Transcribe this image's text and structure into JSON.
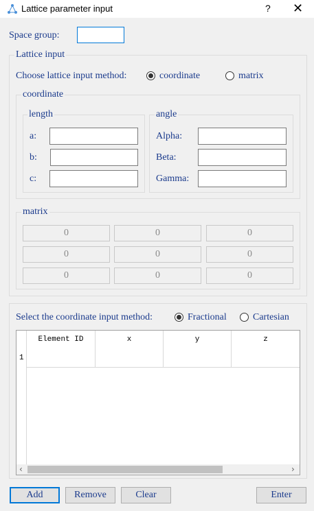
{
  "window": {
    "title": "Lattice parameter input",
    "help_label": "?",
    "close_label": "✕"
  },
  "space_group": {
    "label": "Space group:",
    "value": ""
  },
  "lattice": {
    "group_title": "Lattice input",
    "method_label": "Choose lattice input method:",
    "options": [
      {
        "label": "coordinate",
        "checked": true
      },
      {
        "label": "matrix",
        "checked": false
      }
    ],
    "coordinate": {
      "title": "coordinate",
      "length": {
        "title": "length",
        "fields": [
          {
            "label": "a:",
            "value": ""
          },
          {
            "label": "b:",
            "value": ""
          },
          {
            "label": "c:",
            "value": ""
          }
        ]
      },
      "angle": {
        "title": "angle",
        "fields": [
          {
            "label": "Alpha:",
            "value": ""
          },
          {
            "label": "Beta:",
            "value": ""
          },
          {
            "label": "Gamma:",
            "value": ""
          }
        ]
      }
    },
    "matrix": {
      "title": "matrix",
      "cells": [
        [
          "0",
          "0",
          "0"
        ],
        [
          "0",
          "0",
          "0"
        ],
        [
          "0",
          "0",
          "0"
        ]
      ]
    }
  },
  "coordinates": {
    "method_label": "Select the coordinate input method:",
    "options": [
      {
        "label": "Fractional",
        "checked": true
      },
      {
        "label": "Cartesian",
        "checked": false
      }
    ],
    "table": {
      "columns": [
        "Element ID",
        "x",
        "y",
        "z"
      ],
      "rows": [
        "1"
      ]
    }
  },
  "buttons": {
    "add": "Add",
    "remove": "Remove",
    "clear": "Clear",
    "enter": "Enter"
  },
  "icons": {
    "app": "molecule-icon",
    "scroll_left": "‹",
    "scroll_right": "›"
  }
}
